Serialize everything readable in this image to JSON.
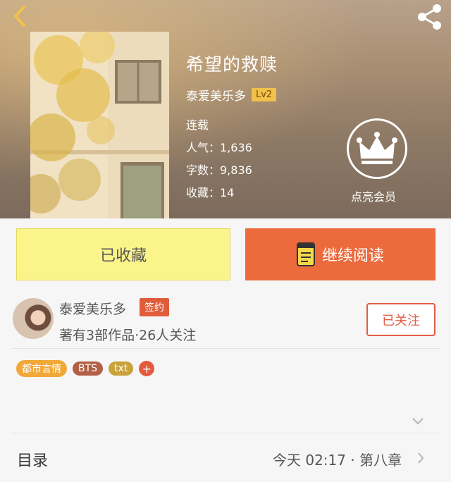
{
  "book": {
    "title": "希望的救赎",
    "author": "泰爱美乐多",
    "level_badge": "Lv2",
    "status": "连载",
    "popularity": "人气：1,636",
    "word_count": "字数：9,836",
    "favorites": "收藏：14"
  },
  "membership": {
    "label": "点亮会员"
  },
  "actions": {
    "favorited_label": "已收藏",
    "continue_label": "继续阅读"
  },
  "author_card": {
    "name": "泰爱美乐多",
    "sign_badge": "签约",
    "works_summary": "著有3部作品·26人关注",
    "follow_label": "已关注"
  },
  "tags": [
    {
      "label": "都市言情",
      "color": "#f2a838"
    },
    {
      "label": "BTS",
      "color": "#b35f48"
    },
    {
      "label": "txt",
      "color": "#c9a23a"
    }
  ],
  "add_tag": "+",
  "catalog": {
    "label": "目录",
    "latest": "今天 02:17 · 第八章"
  },
  "colors": {
    "accent_orange": "#ec6a3b",
    "favorited_yellow": "#fbf48a",
    "lv_badge": "#f0c14b"
  }
}
